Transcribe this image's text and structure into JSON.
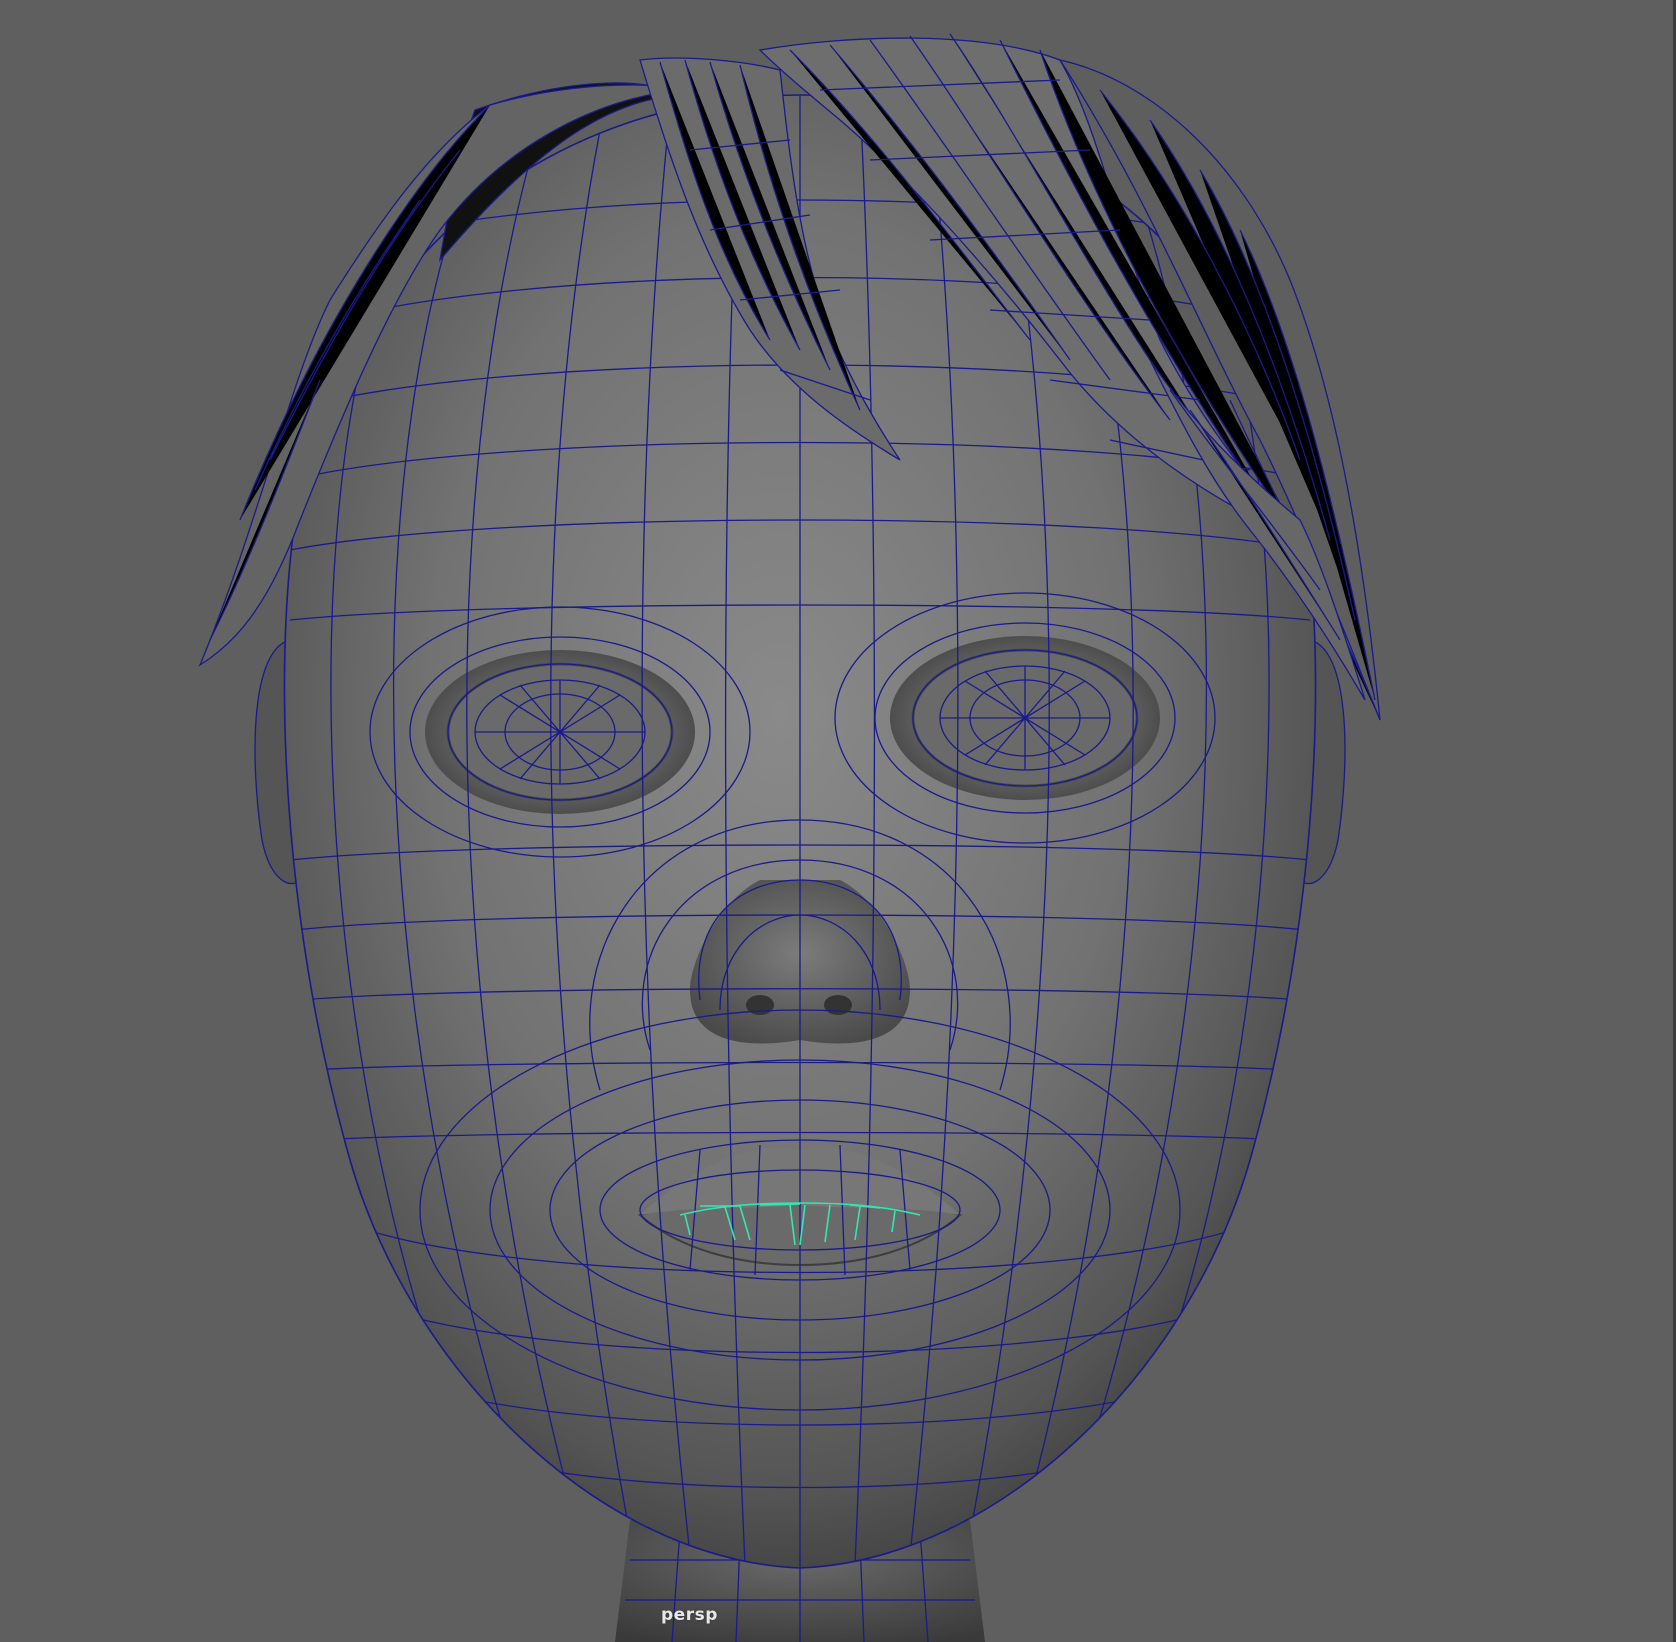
{
  "viewport": {
    "camera_name": "persp",
    "background_color": "#5f5f5f",
    "wireframe_color": "#1a1a8c",
    "selection_color": "#33e6b0",
    "object_type": "polygon head mesh with hair cards (wireframe on shaded)"
  }
}
